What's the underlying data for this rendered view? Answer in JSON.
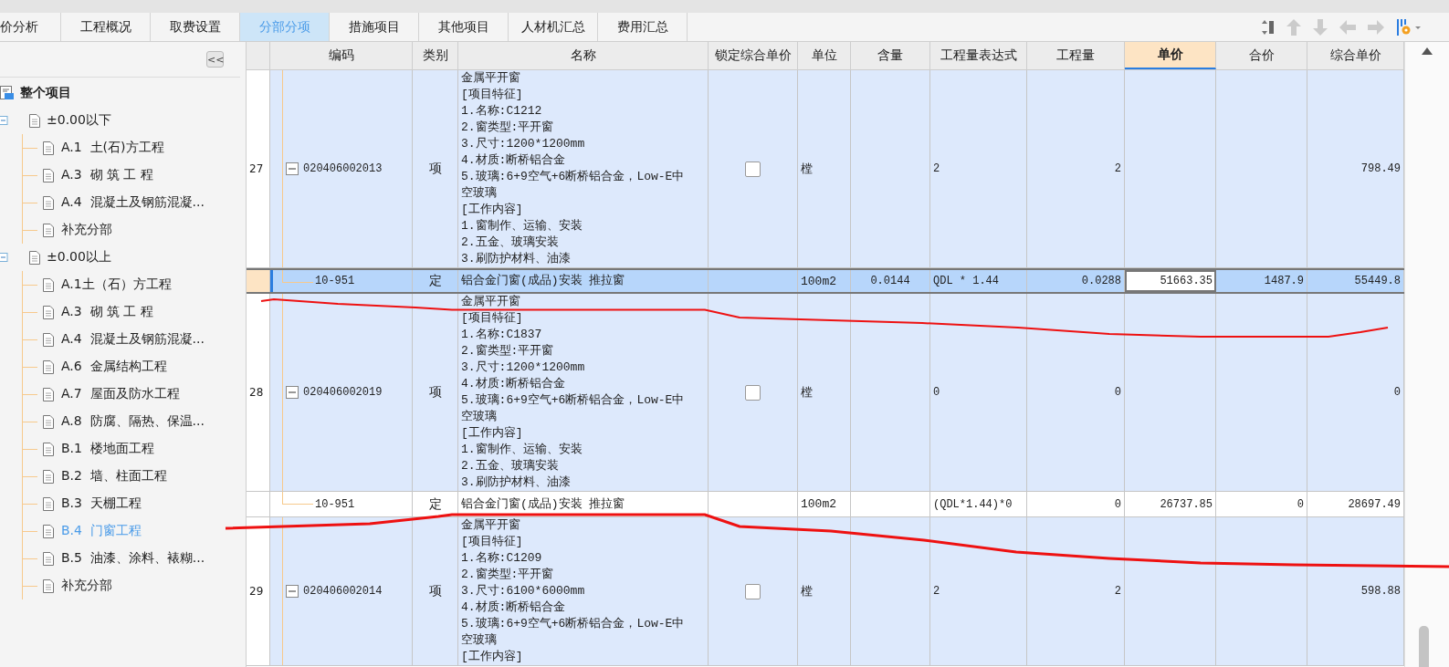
{
  "tabs": [
    {
      "label": "价分析",
      "selected": false
    },
    {
      "label": "工程概况",
      "selected": false
    },
    {
      "label": "取费设置",
      "selected": false
    },
    {
      "label": "分部分项",
      "selected": true
    },
    {
      "label": "措施项目",
      "selected": false
    },
    {
      "label": "其他项目",
      "selected": false
    },
    {
      "label": "人材机汇总",
      "selected": false
    },
    {
      "label": "费用汇总",
      "selected": false
    }
  ],
  "toolbar": [
    {
      "kind": "swap",
      "disabled": false
    },
    {
      "kind": "up",
      "disabled": true
    },
    {
      "kind": "down",
      "disabled": true
    },
    {
      "kind": "left",
      "disabled": true
    },
    {
      "kind": "right",
      "disabled": true
    },
    {
      "kind": "settings",
      "disabled": false
    }
  ],
  "collapse_button": "<<",
  "tree": {
    "label": "整个项目",
    "children": [
      {
        "label": "±0.00以下",
        "expanded": true,
        "selected": false,
        "children": [
          {
            "label": "A.1  土(石)方工程",
            "selected": false
          },
          {
            "label": "A.3  砌 筑 工 程",
            "selected": false
          },
          {
            "label": "A.4  混凝土及钢筋混凝...",
            "selected": false
          },
          {
            "label": "补充分部",
            "selected": false
          }
        ]
      },
      {
        "label": "±0.00以上",
        "expanded": true,
        "selected": false,
        "children": [
          {
            "label": "A.1土（石）方工程",
            "selected": false
          },
          {
            "label": "A.3  砌 筑 工 程",
            "selected": false
          },
          {
            "label": "A.4  混凝土及钢筋混凝...",
            "selected": false
          },
          {
            "label": "A.6  金属结构工程",
            "selected": false
          },
          {
            "label": "A.7  屋面及防水工程",
            "selected": false
          },
          {
            "label": "A.8  防腐、隔热、保温...",
            "selected": false
          },
          {
            "label": "B.1  楼地面工程",
            "selected": false
          },
          {
            "label": "B.2  墙、柱面工程",
            "selected": false
          },
          {
            "label": "B.3  天棚工程",
            "selected": false
          },
          {
            "label": "B.4  门窗工程",
            "selected": true
          },
          {
            "label": "B.5  油漆、涂料、裱糊...",
            "selected": false
          },
          {
            "label": "补充分部",
            "selected": false
          }
        ]
      }
    ]
  },
  "columns": [
    {
      "label": "编码",
      "selected": false
    },
    {
      "label": "类别",
      "selected": false
    },
    {
      "label": "名称",
      "selected": false
    },
    {
      "label": "锁定综合单价",
      "selected": false
    },
    {
      "label": "单位",
      "selected": false
    },
    {
      "label": "含量",
      "selected": false
    },
    {
      "label": "工程量表达式",
      "selected": false
    },
    {
      "label": "工程量",
      "selected": false
    },
    {
      "label": "单价",
      "selected": true
    },
    {
      "label": "合价",
      "selected": false
    },
    {
      "label": "综合单价",
      "selected": false
    }
  ],
  "rows": [
    {
      "kind": "item",
      "selected": false,
      "number": "27",
      "expanded": true,
      "code": "020406002013",
      "category": "项",
      "name": "金属平开窗\n[项目特征]\n1.名称:C1212\n2.窗类型:平开窗\n3.尺寸:1200*1200mm\n4.材质:断桥铝合金\n5.玻璃:6+9空气+6断桥铝合金，Low-E中空玻璃\n[工作内容]\n1.窗制作、运输、安装\n2.五金、玻璃安装\n3.刷防护材料、油漆",
      "locked": false,
      "unit": "樘",
      "quantity_expression": "2",
      "quantity": "2",
      "composite_unit_price": "798.49"
    },
    {
      "kind": "quota",
      "selected": true,
      "code": "10-951",
      "category": "定",
      "name": "铝合金门窗(成品)安装 推拉窗",
      "unit": "100m2",
      "content": "0.0144",
      "quantity_expression": "QDL * 1.44",
      "quantity": "0.0288",
      "unit_price": "51663.35",
      "total_price": "1487.9",
      "composite_unit_price": "55449.8"
    },
    {
      "kind": "item",
      "selected": false,
      "number": "28",
      "expanded": true,
      "code": "020406002019",
      "category": "项",
      "name": "金属平开窗\n[项目特征]\n1.名称:C1837\n2.窗类型:平开窗\n3.尺寸:1200*1200mm\n4.材质:断桥铝合金\n5.玻璃:6+9空气+6断桥铝合金，Low-E中空玻璃\n[工作内容]\n1.窗制作、运输、安装\n2.五金、玻璃安装\n3.刷防护材料、油漆",
      "locked": false,
      "unit": "樘",
      "quantity_expression": "0",
      "quantity": "0",
      "composite_unit_price": "0"
    },
    {
      "kind": "quota",
      "selected": false,
      "code": "10-951",
      "category": "定",
      "name": "铝合金门窗(成品)安装 推拉窗",
      "unit": "100m2",
      "quantity_expression": "(QDL*1.44)*0",
      "quantity": "0",
      "unit_price": "26737.85",
      "total_price": "0",
      "composite_unit_price": "28697.49"
    },
    {
      "kind": "item",
      "selected": false,
      "number": "29",
      "expanded": true,
      "code": "020406002014",
      "category": "项",
      "name": "金属平开窗\n[项目特征]\n1.名称:C1209\n2.窗类型:平开窗\n3.尺寸:6100*6000mm\n4.材质:断桥铝合金\n5.玻璃:6+9空气+6断桥铝合金，Low-E中空玻璃\n[工作内容]",
      "locked": false,
      "unit": "樘",
      "quantity_expression": "2",
      "quantity": "2",
      "composite_unit_price": "598.88"
    }
  ]
}
